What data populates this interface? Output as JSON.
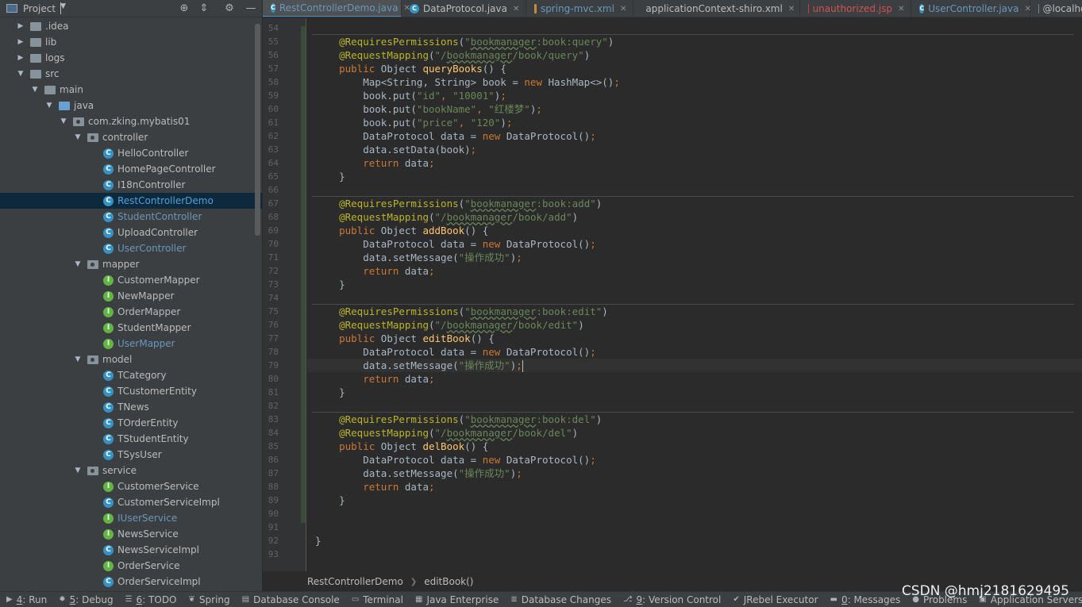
{
  "project_panel": {
    "title": "Project",
    "tree": [
      {
        "label": ".idea",
        "depth": 0,
        "arrow": "right",
        "icon": "folder"
      },
      {
        "label": "lib",
        "depth": 0,
        "arrow": "right",
        "icon": "folder"
      },
      {
        "label": "logs",
        "depth": 0,
        "arrow": "right",
        "icon": "folder"
      },
      {
        "label": "src",
        "depth": 0,
        "arrow": "down",
        "icon": "folder"
      },
      {
        "label": "main",
        "depth": 1,
        "arrow": "down",
        "icon": "folder"
      },
      {
        "label": "java",
        "depth": 2,
        "arrow": "down",
        "icon": "source-folder"
      },
      {
        "label": "com.zking.mybatis01",
        "depth": 3,
        "arrow": "down",
        "icon": "package"
      },
      {
        "label": "controller",
        "depth": 4,
        "arrow": "down",
        "icon": "package"
      },
      {
        "label": "HelloController",
        "depth": 5,
        "icon": "class"
      },
      {
        "label": "HomePageController",
        "depth": 5,
        "icon": "class"
      },
      {
        "label": "I18nController",
        "depth": 5,
        "icon": "class"
      },
      {
        "label": "RestControllerDemo",
        "depth": 5,
        "icon": "class",
        "selected": true
      },
      {
        "label": "StudentController",
        "depth": 5,
        "icon": "class",
        "modified": true
      },
      {
        "label": "UploadController",
        "depth": 5,
        "icon": "class"
      },
      {
        "label": "UserController",
        "depth": 5,
        "icon": "class",
        "modified": true
      },
      {
        "label": "mapper",
        "depth": 4,
        "arrow": "down",
        "icon": "package"
      },
      {
        "label": "CustomerMapper",
        "depth": 5,
        "icon": "interface"
      },
      {
        "label": "NewMapper",
        "depth": 5,
        "icon": "interface"
      },
      {
        "label": "OrderMapper",
        "depth": 5,
        "icon": "interface"
      },
      {
        "label": "StudentMapper",
        "depth": 5,
        "icon": "interface"
      },
      {
        "label": "UserMapper",
        "depth": 5,
        "icon": "interface",
        "modified": true
      },
      {
        "label": "model",
        "depth": 4,
        "arrow": "down",
        "icon": "package"
      },
      {
        "label": "TCategory",
        "depth": 5,
        "icon": "class"
      },
      {
        "label": "TCustomerEntity",
        "depth": 5,
        "icon": "class"
      },
      {
        "label": "TNews",
        "depth": 5,
        "icon": "class"
      },
      {
        "label": "TOrderEntity",
        "depth": 5,
        "icon": "class"
      },
      {
        "label": "TStudentEntity",
        "depth": 5,
        "icon": "class"
      },
      {
        "label": "TSysUser",
        "depth": 5,
        "icon": "class"
      },
      {
        "label": "service",
        "depth": 4,
        "arrow": "down",
        "icon": "package"
      },
      {
        "label": "CustomerService",
        "depth": 5,
        "icon": "interface"
      },
      {
        "label": "CustomerServiceImpl",
        "depth": 5,
        "icon": "class"
      },
      {
        "label": "IUserService",
        "depth": 5,
        "icon": "interface",
        "modified": true
      },
      {
        "label": "NewsService",
        "depth": 5,
        "icon": "interface"
      },
      {
        "label": "NewsServiceImpl",
        "depth": 5,
        "icon": "class"
      },
      {
        "label": "OrderService",
        "depth": 5,
        "icon": "interface"
      },
      {
        "label": "OrderServiceImpl",
        "depth": 5,
        "icon": "class"
      }
    ]
  },
  "tabs": [
    {
      "label": "RestControllerDemo.java",
      "icon": "class",
      "active": true,
      "color": "modified"
    },
    {
      "label": "DataProtocol.java",
      "icon": "class"
    },
    {
      "label": "spring-mvc.xml",
      "icon": "xml",
      "color": "modified"
    },
    {
      "label": "applicationContext-shiro.xml",
      "icon": "xml"
    },
    {
      "label": "unauthorized.jsp",
      "icon": "jsp",
      "color": "error"
    },
    {
      "label": "UserController.java",
      "icon": "class",
      "color": "modified"
    },
    {
      "label": "@localhost",
      "icon": "db",
      "no_close": true
    }
  ],
  "editor": {
    "first_line": 54,
    "line_numbers": [
      "54",
      "55",
      "56",
      "57",
      "58",
      "59",
      "60",
      "61",
      "62",
      "63",
      "64",
      "65",
      "66",
      "67",
      "68",
      "69",
      "70",
      "71",
      "72",
      "73",
      "74",
      "75",
      "76",
      "77",
      "78",
      "79",
      "80",
      "81",
      "82",
      "83",
      "84",
      "85",
      "86",
      "87",
      "88",
      "89",
      "90",
      "91",
      "92",
      "93"
    ],
    "current_line": 79,
    "lines": [
      [],
      [
        [
          "    ",
          ""
        ],
        [
          "@RequiresPermissions",
          "a"
        ],
        [
          "(",
          ""
        ],
        [
          "\"",
          "s"
        ],
        [
          "bookmanager",
          "su"
        ],
        [
          ":book:query\"",
          "s"
        ],
        [
          ")",
          ""
        ]
      ],
      [
        [
          "    ",
          ""
        ],
        [
          "@RequestMapping",
          "a"
        ],
        [
          "(",
          ""
        ],
        [
          "\"/",
          "s"
        ],
        [
          "bookmanager",
          "su"
        ],
        [
          "/book/query\"",
          "s"
        ],
        [
          ")",
          ""
        ]
      ],
      [
        [
          "    ",
          ""
        ],
        [
          "public ",
          "k"
        ],
        [
          "Object ",
          ""
        ],
        [
          "queryBooks",
          "f"
        ],
        [
          "() {",
          ""
        ]
      ],
      [
        [
          "        Map<String, String> book = ",
          ""
        ],
        [
          "new ",
          "k"
        ],
        [
          "HashMap<>()",
          ""
        ],
        [
          ";",
          "k"
        ]
      ],
      [
        [
          "        book.put(",
          ""
        ],
        [
          "\"id\"",
          "s"
        ],
        [
          ", ",
          "k"
        ],
        [
          "\"10001\"",
          "s"
        ],
        [
          ")",
          ""
        ],
        [
          ";",
          "k"
        ]
      ],
      [
        [
          "        book.put(",
          ""
        ],
        [
          "\"bookName\"",
          "s"
        ],
        [
          ", ",
          "k"
        ],
        [
          "\"红楼梦\"",
          "s"
        ],
        [
          ")",
          ""
        ],
        [
          ";",
          "k"
        ]
      ],
      [
        [
          "        book.put(",
          ""
        ],
        [
          "\"price\"",
          "s"
        ],
        [
          ", ",
          "k"
        ],
        [
          "\"120\"",
          "s"
        ],
        [
          ")",
          ""
        ],
        [
          ";",
          "k"
        ]
      ],
      [
        [
          "        DataProtocol data = ",
          ""
        ],
        [
          "new ",
          "k"
        ],
        [
          "DataProtocol()",
          ""
        ],
        [
          ";",
          "k"
        ]
      ],
      [
        [
          "        data.setData(book)",
          ""
        ],
        [
          ";",
          "k"
        ]
      ],
      [
        [
          "        ",
          ""
        ],
        [
          "return ",
          "k"
        ],
        [
          "data",
          ""
        ],
        [
          ";",
          "k"
        ]
      ],
      [
        [
          "    }",
          ""
        ]
      ],
      [],
      [
        [
          "    ",
          ""
        ],
        [
          "@RequiresPermissions",
          "a"
        ],
        [
          "(",
          ""
        ],
        [
          "\"",
          "s"
        ],
        [
          "bookmanager",
          "su"
        ],
        [
          ":book:add\"",
          "s"
        ],
        [
          ")",
          ""
        ]
      ],
      [
        [
          "    ",
          ""
        ],
        [
          "@RequestMapping",
          "a"
        ],
        [
          "(",
          ""
        ],
        [
          "\"/",
          "s"
        ],
        [
          "bookmanager",
          "su"
        ],
        [
          "/book/add\"",
          "s"
        ],
        [
          ")",
          ""
        ]
      ],
      [
        [
          "    ",
          ""
        ],
        [
          "public ",
          "k"
        ],
        [
          "Object ",
          ""
        ],
        [
          "addBook",
          "f"
        ],
        [
          "() {",
          ""
        ]
      ],
      [
        [
          "        DataProtocol data = ",
          ""
        ],
        [
          "new ",
          "k"
        ],
        [
          "DataProtocol()",
          ""
        ],
        [
          ";",
          "k"
        ]
      ],
      [
        [
          "        data.setMessage(",
          ""
        ],
        [
          "\"操作成功\"",
          "s"
        ],
        [
          ")",
          ""
        ],
        [
          ";",
          "k"
        ]
      ],
      [
        [
          "        ",
          ""
        ],
        [
          "return ",
          "k"
        ],
        [
          "data",
          ""
        ],
        [
          ";",
          "k"
        ]
      ],
      [
        [
          "    }",
          ""
        ]
      ],
      [],
      [
        [
          "    ",
          ""
        ],
        [
          "@RequiresPermissions",
          "a"
        ],
        [
          "(",
          ""
        ],
        [
          "\"",
          "s"
        ],
        [
          "bookmanager",
          "su"
        ],
        [
          ":book:edit\"",
          "s"
        ],
        [
          ")",
          ""
        ]
      ],
      [
        [
          "    ",
          ""
        ],
        [
          "@RequestMapping",
          "a"
        ],
        [
          "(",
          ""
        ],
        [
          "\"/",
          "s"
        ],
        [
          "bookmanager",
          "su"
        ],
        [
          "/book/edit\"",
          "s"
        ],
        [
          ")",
          ""
        ]
      ],
      [
        [
          "    ",
          ""
        ],
        [
          "public ",
          "k"
        ],
        [
          "Object ",
          ""
        ],
        [
          "editBook",
          "f"
        ],
        [
          "() {",
          ""
        ]
      ],
      [
        [
          "        DataProtocol data = ",
          ""
        ],
        [
          "new ",
          "k"
        ],
        [
          "DataProtocol()",
          ""
        ],
        [
          ";",
          "k"
        ]
      ],
      [
        [
          "        data.setMessage(",
          ""
        ],
        [
          "\"操作成功\"",
          "s"
        ],
        [
          ")",
          ""
        ],
        [
          ";",
          "k"
        ]
      ],
      [
        [
          "        ",
          ""
        ],
        [
          "return ",
          "k"
        ],
        [
          "data",
          ""
        ],
        [
          ";",
          "k"
        ]
      ],
      [
        [
          "    }",
          ""
        ]
      ],
      [],
      [
        [
          "    ",
          ""
        ],
        [
          "@RequiresPermissions",
          "a"
        ],
        [
          "(",
          ""
        ],
        [
          "\"",
          "s"
        ],
        [
          "bookmanager",
          "su"
        ],
        [
          ":book:del\"",
          "s"
        ],
        [
          ")",
          ""
        ]
      ],
      [
        [
          "    ",
          ""
        ],
        [
          "@RequestMapping",
          "a"
        ],
        [
          "(",
          ""
        ],
        [
          "\"/",
          "s"
        ],
        [
          "bookmanager",
          "su"
        ],
        [
          "/book/del\"",
          "s"
        ],
        [
          ")",
          ""
        ]
      ],
      [
        [
          "    ",
          ""
        ],
        [
          "public ",
          "k"
        ],
        [
          "Object ",
          ""
        ],
        [
          "delBook",
          "f"
        ],
        [
          "() {",
          ""
        ]
      ],
      [
        [
          "        DataProtocol data = ",
          ""
        ],
        [
          "new ",
          "k"
        ],
        [
          "DataProtocol()",
          ""
        ],
        [
          ";",
          "k"
        ]
      ],
      [
        [
          "        data.setMessage(",
          ""
        ],
        [
          "\"操作成功\"",
          "s"
        ],
        [
          ")",
          ""
        ],
        [
          ";",
          "k"
        ]
      ],
      [
        [
          "        ",
          ""
        ],
        [
          "return ",
          "k"
        ],
        [
          "data",
          ""
        ],
        [
          ";",
          "k"
        ]
      ],
      [
        [
          "    }",
          ""
        ]
      ],
      [],
      [],
      [
        [
          "}",
          ""
        ]
      ],
      []
    ],
    "method_separator_lines": [
      54,
      66,
      74,
      82
    ]
  },
  "breadcrumb": [
    "RestControllerDemo",
    "editBook()"
  ],
  "bottom_toolbar": [
    {
      "icon": "run-icon",
      "glyph": "▶",
      "mnemonic": "4",
      "label": ": Run"
    },
    {
      "icon": "debug-icon",
      "glyph": "✹",
      "mnemonic": "5",
      "label": ": Debug"
    },
    {
      "icon": "todo-icon",
      "glyph": "☰",
      "mnemonic": "6",
      "label": ": TODO"
    },
    {
      "icon": "spring-icon",
      "glyph": "❦",
      "mnemonic": "",
      "label": "Spring"
    },
    {
      "icon": "database-console-icon",
      "glyph": "▤",
      "mnemonic": "",
      "label": "Database Console"
    },
    {
      "icon": "terminal-icon",
      "glyph": "▭",
      "mnemonic": "",
      "label": "Terminal"
    },
    {
      "icon": "java-enterprise-icon",
      "glyph": "▦",
      "mnemonic": "",
      "label": "Java Enterprise"
    },
    {
      "icon": "database-changes-icon",
      "glyph": "≣",
      "mnemonic": "",
      "label": "Database Changes"
    },
    {
      "icon": "version-control-icon",
      "glyph": "⎇",
      "mnemonic": "9",
      "label": ": Version Control"
    },
    {
      "icon": "jrebel-icon",
      "glyph": "✔",
      "mnemonic": "",
      "label": "JRebel Executor"
    },
    {
      "icon": "messages-icon",
      "glyph": "▬",
      "mnemonic": "0",
      "label": ": Messages"
    },
    {
      "icon": "problems-icon",
      "glyph": "●",
      "mnemonic": "",
      "label": "Problems"
    },
    {
      "icon": "application-servers-icon",
      "glyph": "▣",
      "mnemonic": "",
      "label": "Application Servers"
    }
  ],
  "watermark": "CSDN @hmj2181629495",
  "colors": {
    "keyword": "#cc7832",
    "string": "#6a8759",
    "annotation": "#bbb529",
    "function": "#ffc66d",
    "modified_file": "#6897bb",
    "error_file": "#d25252",
    "selection": "#0d293e"
  }
}
